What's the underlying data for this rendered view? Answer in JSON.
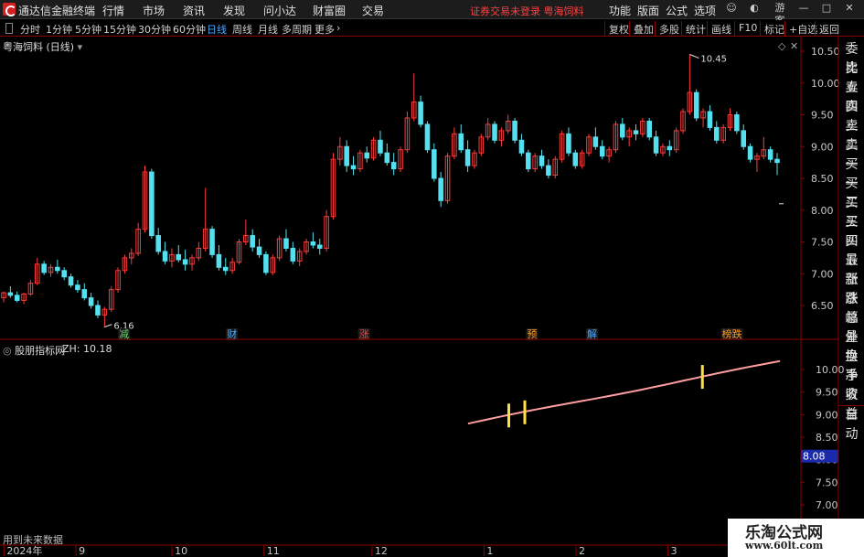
{
  "app": {
    "title": "通达信金融终端",
    "menu": [
      "行情",
      "市场",
      "资讯",
      "发现",
      "问小达",
      "财富圈",
      "交易"
    ],
    "status": "证券交易未登录  粤海饲料"
  },
  "titlebar_right": [
    "功能",
    "版面",
    "公式",
    "选项"
  ],
  "guest_label": "游客",
  "toolbar": {
    "periods": [
      "分时",
      "1分钟",
      "5分钟",
      "15分钟",
      "30分钟",
      "60分钟",
      "日线",
      "周线",
      "月线",
      "多周期",
      "更多"
    ],
    "active_period": "日线",
    "right_buttons": [
      "复权",
      "叠加",
      "多股",
      "统计",
      "画线",
      "F10",
      "标记",
      "+自选",
      "返回"
    ]
  },
  "chart": {
    "title": "粤海饲料 (日线)",
    "high_label": "10.45",
    "low_label": "6.16",
    "y_ticks": [
      "10.50",
      "10.00",
      "9.50",
      "9.00",
      "8.50",
      "8.00",
      "7.50",
      "7.00",
      "6.50"
    ]
  },
  "sidebar": [
    "委比",
    "卖五",
    "卖四",
    "卖三",
    "卖二",
    "卖一",
    "买一",
    "买二",
    "买三",
    "买四",
    "买五",
    "最新",
    "涨跌",
    "涨幅",
    "总量",
    "外盘",
    "换手",
    "净资",
    "收益",
    "自动"
  ],
  "markers": [
    {
      "label": "减",
      "color": "#5fd35f",
      "pos": 0.155
    },
    {
      "label": "财",
      "color": "#4aa8ff",
      "pos": 0.29
    },
    {
      "label": "涨",
      "color": "#ff4040",
      "pos": 0.455
    },
    {
      "label": "预",
      "color": "#ff9a20",
      "pos": 0.665
    },
    {
      "label": "解",
      "color": "#4aa8ff",
      "pos": 0.74
    },
    {
      "label": "榜跌",
      "color": "#ff9a20",
      "pos": 0.915
    }
  ],
  "indicator": {
    "name": "股朋指标网",
    "zh_label": "ZH: 10.18",
    "value_box": "8.08",
    "y_ticks": [
      "10.00",
      "9.50",
      "9.00",
      "8.50",
      "8.00",
      "7.50",
      "7.00"
    ]
  },
  "x_axis": [
    "2024年",
    "9",
    "10",
    "11",
    "12",
    "1",
    "2",
    "3"
  ],
  "bottom_text": "用到未来数据",
  "watermark": {
    "line1": "乐淘公式网",
    "line2": "www.60lt.com"
  },
  "colors": {
    "up": "#ff3b3b",
    "down": "#55e0f0",
    "ind_line": "#ff9ea0",
    "ind_mark": "#ffe040",
    "axis": "#8b0000"
  },
  "chart_data": {
    "type": "candlestick",
    "ylim": [
      6.3,
      10.55
    ],
    "candles": [
      [
        6.62,
        6.72,
        6.55,
        6.7
      ],
      [
        6.7,
        6.8,
        6.62,
        6.66
      ],
      [
        6.66,
        6.72,
        6.55,
        6.58
      ],
      [
        6.58,
        6.7,
        6.52,
        6.68
      ],
      [
        6.68,
        6.9,
        6.65,
        6.85
      ],
      [
        6.85,
        7.25,
        6.82,
        7.15
      ],
      [
        7.15,
        7.2,
        6.98,
        7.02
      ],
      [
        7.02,
        7.15,
        6.95,
        7.1
      ],
      [
        7.1,
        7.22,
        7.0,
        7.05
      ],
      [
        7.05,
        7.1,
        6.9,
        6.95
      ],
      [
        6.95,
        7.0,
        6.78,
        6.82
      ],
      [
        6.82,
        6.9,
        6.7,
        6.75
      ],
      [
        6.75,
        6.85,
        6.58,
        6.62
      ],
      [
        6.62,
        6.7,
        6.45,
        6.5
      ],
      [
        6.5,
        6.58,
        6.3,
        6.35
      ],
      [
        6.35,
        6.48,
        6.16,
        6.44
      ],
      [
        6.44,
        6.8,
        6.4,
        6.75
      ],
      [
        6.75,
        7.1,
        6.7,
        7.05
      ],
      [
        7.05,
        7.3,
        7.0,
        7.25
      ],
      [
        7.25,
        7.4,
        7.15,
        7.32
      ],
      [
        7.32,
        7.8,
        7.28,
        7.7
      ],
      [
        7.7,
        8.7,
        7.65,
        8.6
      ],
      [
        8.6,
        8.65,
        7.55,
        7.6
      ],
      [
        7.6,
        7.72,
        7.3,
        7.35
      ],
      [
        7.35,
        7.5,
        7.15,
        7.2
      ],
      [
        7.2,
        7.4,
        7.1,
        7.3
      ],
      [
        7.3,
        7.45,
        7.18,
        7.22
      ],
      [
        7.22,
        7.38,
        7.05,
        7.15
      ],
      [
        7.15,
        7.3,
        7.05,
        7.25
      ],
      [
        7.25,
        7.5,
        7.2,
        7.4
      ],
      [
        7.4,
        8.35,
        7.35,
        7.7
      ],
      [
        7.7,
        7.75,
        7.25,
        7.3
      ],
      [
        7.3,
        7.45,
        7.05,
        7.1
      ],
      [
        7.1,
        7.25,
        6.98,
        7.05
      ],
      [
        7.05,
        7.25,
        7.0,
        7.18
      ],
      [
        7.18,
        7.55,
        7.15,
        7.5
      ],
      [
        7.5,
        7.85,
        7.45,
        7.6
      ],
      [
        7.6,
        7.7,
        7.35,
        7.42
      ],
      [
        7.42,
        7.55,
        7.25,
        7.3
      ],
      [
        7.3,
        7.35,
        6.98,
        7.02
      ],
      [
        7.02,
        7.3,
        6.98,
        7.25
      ],
      [
        7.25,
        7.6,
        7.2,
        7.55
      ],
      [
        7.55,
        7.7,
        7.35,
        7.4
      ],
      [
        7.4,
        7.5,
        7.15,
        7.2
      ],
      [
        7.2,
        7.4,
        7.12,
        7.35
      ],
      [
        7.35,
        7.55,
        7.3,
        7.5
      ],
      [
        7.5,
        7.65,
        7.4,
        7.45
      ],
      [
        7.45,
        7.55,
        7.3,
        7.4
      ],
      [
        7.4,
        8.0,
        7.35,
        7.9
      ],
      [
        7.9,
        8.9,
        7.85,
        8.8
      ],
      [
        8.8,
        9.15,
        8.7,
        9.0
      ],
      [
        9.0,
        9.1,
        8.6,
        8.7
      ],
      [
        8.7,
        8.85,
        8.55,
        8.65
      ],
      [
        8.65,
        8.95,
        8.6,
        8.9
      ],
      [
        8.9,
        9.0,
        8.75,
        8.82
      ],
      [
        8.82,
        9.15,
        8.78,
        9.1
      ],
      [
        9.1,
        9.25,
        8.85,
        8.9
      ],
      [
        8.9,
        9.05,
        8.7,
        8.75
      ],
      [
        8.75,
        8.9,
        8.55,
        8.65
      ],
      [
        8.65,
        9.0,
        8.6,
        8.95
      ],
      [
        8.95,
        9.55,
        8.9,
        9.45
      ],
      [
        9.45,
        10.15,
        9.4,
        9.7
      ],
      [
        9.7,
        9.8,
        9.3,
        9.35
      ],
      [
        9.35,
        9.4,
        8.9,
        8.95
      ],
      [
        8.95,
        9.05,
        8.45,
        8.5
      ],
      [
        8.5,
        8.6,
        8.05,
        8.15
      ],
      [
        8.15,
        8.9,
        8.1,
        8.85
      ],
      [
        8.85,
        9.3,
        8.8,
        9.2
      ],
      [
        9.2,
        9.35,
        8.9,
        8.95
      ],
      [
        8.95,
        9.1,
        8.6,
        8.7
      ],
      [
        8.7,
        8.95,
        8.65,
        8.9
      ],
      [
        8.9,
        9.2,
        8.85,
        9.15
      ],
      [
        9.15,
        9.45,
        9.1,
        9.35
      ],
      [
        9.35,
        9.4,
        9.05,
        9.1
      ],
      [
        9.1,
        9.3,
        9.0,
        9.25
      ],
      [
        9.25,
        9.5,
        9.2,
        9.4
      ],
      [
        9.4,
        9.45,
        9.05,
        9.1
      ],
      [
        9.1,
        9.2,
        8.85,
        8.9
      ],
      [
        8.9,
        8.95,
        8.6,
        8.65
      ],
      [
        8.65,
        8.9,
        8.6,
        8.85
      ],
      [
        8.85,
        8.95,
        8.65,
        8.7
      ],
      [
        8.7,
        8.8,
        8.5,
        8.55
      ],
      [
        8.55,
        8.85,
        8.5,
        8.8
      ],
      [
        8.8,
        9.25,
        8.75,
        9.2
      ],
      [
        9.2,
        9.3,
        8.85,
        8.9
      ],
      [
        8.9,
        8.95,
        8.65,
        8.7
      ],
      [
        8.7,
        8.95,
        8.65,
        8.9
      ],
      [
        8.9,
        9.2,
        8.85,
        9.15
      ],
      [
        9.15,
        9.3,
        8.95,
        9.0
      ],
      [
        9.0,
        9.1,
        8.8,
        8.85
      ],
      [
        8.85,
        9.0,
        8.75,
        8.95
      ],
      [
        8.95,
        9.4,
        8.9,
        9.35
      ],
      [
        9.35,
        9.45,
        9.1,
        9.15
      ],
      [
        9.15,
        9.3,
        9.0,
        9.25
      ],
      [
        9.25,
        9.35,
        9.1,
        9.2
      ],
      [
        9.2,
        9.45,
        9.15,
        9.4
      ],
      [
        9.4,
        9.45,
        9.1,
        9.15
      ],
      [
        9.15,
        9.25,
        8.85,
        8.9
      ],
      [
        8.9,
        9.05,
        8.85,
        9.0
      ],
      [
        9.0,
        9.1,
        8.85,
        8.95
      ],
      [
        8.95,
        9.3,
        8.9,
        9.25
      ],
      [
        9.25,
        9.6,
        9.2,
        9.55
      ],
      [
        9.55,
        10.45,
        9.5,
        9.85
      ],
      [
        9.85,
        9.9,
        9.4,
        9.45
      ],
      [
        9.45,
        9.6,
        9.3,
        9.55
      ],
      [
        9.55,
        9.65,
        9.25,
        9.3
      ],
      [
        9.3,
        9.4,
        9.05,
        9.1
      ],
      [
        9.1,
        9.35,
        9.05,
        9.3
      ],
      [
        9.3,
        9.6,
        9.25,
        9.5
      ],
      [
        9.5,
        9.55,
        9.2,
        9.25
      ],
      [
        9.25,
        9.35,
        8.95,
        9.0
      ],
      [
        9.0,
        9.05,
        8.75,
        8.8
      ],
      [
        8.8,
        8.9,
        8.6,
        8.85
      ],
      [
        8.85,
        9.15,
        8.8,
        8.95
      ],
      [
        8.95,
        9.0,
        8.75,
        8.8
      ],
      [
        8.8,
        8.9,
        8.55,
        8.75
      ]
    ],
    "indicator_line": {
      "start_pos": 0.585,
      "end_pos": 0.975,
      "start": 8.8,
      "end": 10.18
    },
    "indicator_marks": [
      0.636,
      0.656,
      0.878
    ]
  }
}
